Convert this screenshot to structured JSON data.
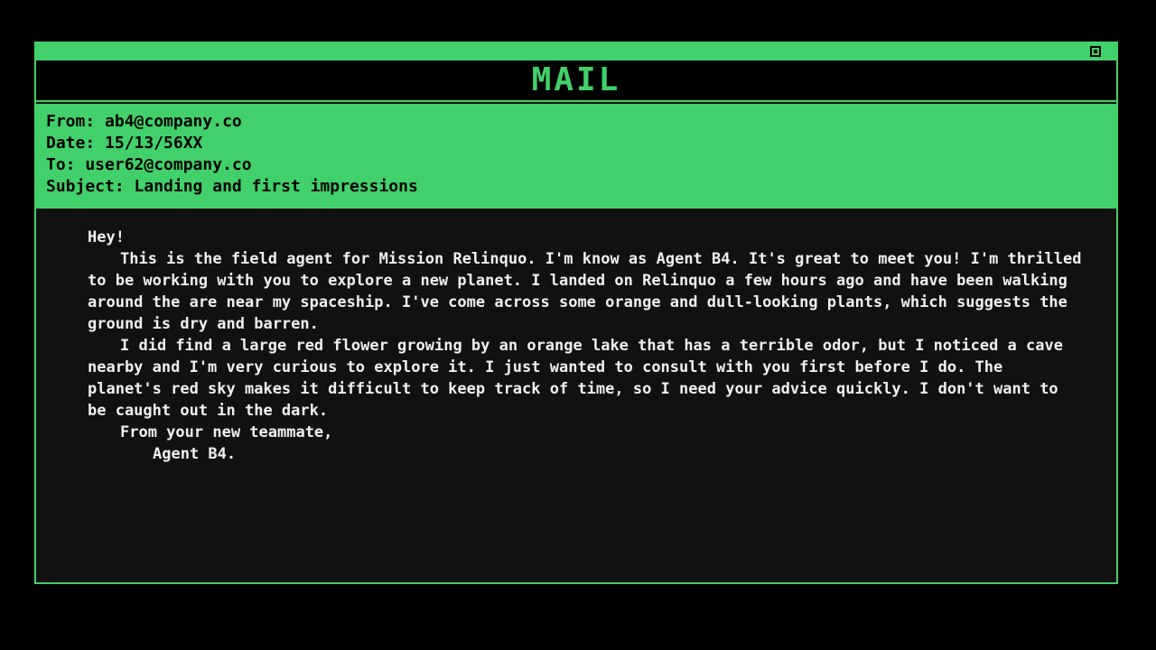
{
  "window": {
    "title": "MAIL",
    "accent_color": "#42d06a",
    "close_icon": "close-square-icon"
  },
  "header": {
    "from": "From: ab4@company.co",
    "date": "Date: 15/13/56XX",
    "to": "To: user62@company.co",
    "subject": "Subject: Landing and first impressions"
  },
  "body": {
    "greeting": "Hey!",
    "paragraph1": "This is the field agent for Mission Relinquo. I'm know as Agent B4. It's great to meet you! I'm thrilled to be working with you to explore a new planet. I landed on Relinquo a few hours ago and have been walking around the are near my spaceship. I've come across some orange and dull-looking plants, which suggests the ground is dry and barren.",
    "paragraph2": "I did find a large red flower growing by an orange lake that has a terrible odor, but I noticed a cave nearby and I'm very curious to explore it. I just wanted to consult with you first before I do. The planet's red sky makes it difficult to keep track of time, so I need your advice quickly. I don't want to be caught out in the dark.",
    "signoff": "From your new teammate,",
    "signature": "Agent B4."
  }
}
